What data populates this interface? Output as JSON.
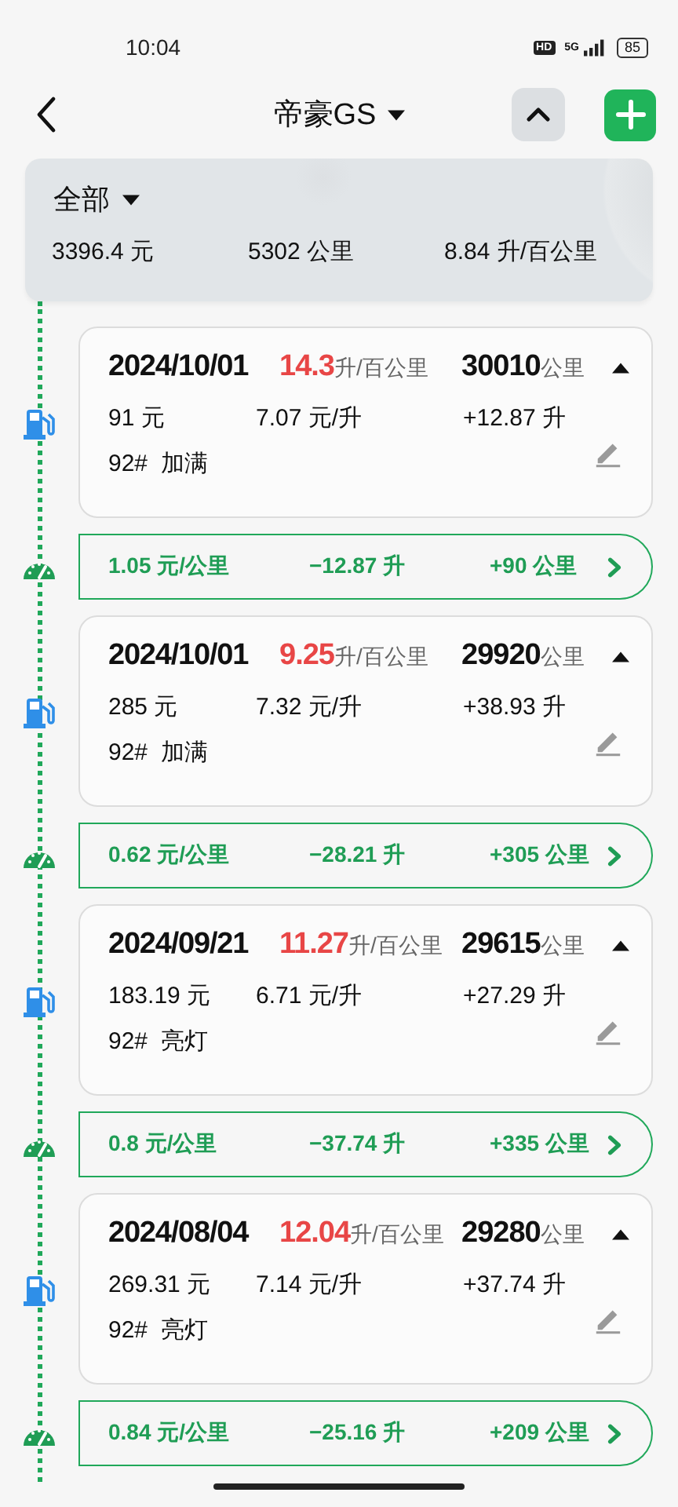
{
  "status_bar": {
    "time": "10:04",
    "hd_badge": "HD",
    "network": "5G",
    "battery": "85"
  },
  "header": {
    "title": "帝豪GS"
  },
  "summary": {
    "filter": "全部",
    "total_cost": "3396.4 元",
    "total_distance": "5302 公里",
    "average_consumption": "8.84 升/百公里"
  },
  "timeline": [
    {
      "kind": "refuel",
      "date": "2024/10/01",
      "consumption": "14.3",
      "consumption_unit": "升/百公里",
      "odometer": "30010",
      "odometer_unit": "公里",
      "amount": "91 元",
      "unit_price": "7.07 元/升",
      "volume": "+12.87 升",
      "note": "92#  加满",
      "expanded": true
    },
    {
      "kind": "segment",
      "cost_per_km": "1.05 元/公里",
      "fuel_used": "−12.87 升",
      "distance": "+90 公里"
    },
    {
      "kind": "refuel",
      "date": "2024/10/01",
      "consumption": "9.25",
      "consumption_unit": "升/百公里",
      "odometer": "29920",
      "odometer_unit": "公里",
      "amount": "285 元",
      "unit_price": "7.32 元/升",
      "volume": "+38.93 升",
      "note": "92#  加满",
      "expanded": true
    },
    {
      "kind": "segment",
      "cost_per_km": "0.62 元/公里",
      "fuel_used": "−28.21 升",
      "distance": "+305 公里"
    },
    {
      "kind": "refuel",
      "date": "2024/09/21",
      "consumption": "11.27",
      "consumption_unit": "升/百公里",
      "odometer": "29615",
      "odometer_unit": "公里",
      "amount": "183.19 元",
      "unit_price": "6.71 元/升",
      "volume": "+27.29 升",
      "note": "92#  亮灯",
      "expanded": true
    },
    {
      "kind": "segment",
      "cost_per_km": "0.8 元/公里",
      "fuel_used": "−37.74 升",
      "distance": "+335 公里"
    },
    {
      "kind": "refuel",
      "date": "2024/08/04",
      "consumption": "12.04",
      "consumption_unit": "升/百公里",
      "odometer": "29280",
      "odometer_unit": "公里",
      "amount": "269.31 元",
      "unit_price": "7.14 元/升",
      "volume": "+37.74 升",
      "note": "92#  亮灯",
      "expanded": true
    },
    {
      "kind": "segment",
      "cost_per_km": "0.84 元/公里",
      "fuel_used": "−25.16 升",
      "distance": "+209 公里"
    }
  ]
}
